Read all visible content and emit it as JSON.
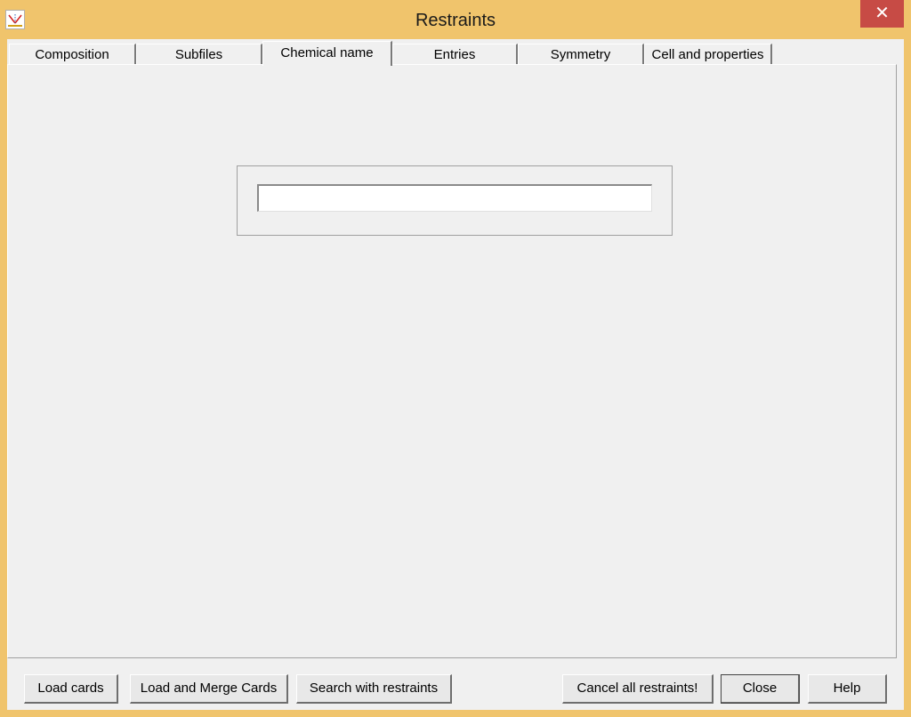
{
  "window": {
    "title": "Restraints",
    "close_glyph": "✕",
    "accent_color": "#f0c46c",
    "close_color": "#c74b45"
  },
  "tabs": [
    {
      "label": "Composition",
      "active": false
    },
    {
      "label": "Subfiles",
      "active": false
    },
    {
      "label": "Chemical name",
      "active": true
    },
    {
      "label": "Entries",
      "active": false
    },
    {
      "label": "Symmetry",
      "active": false
    },
    {
      "label": "Cell and properties",
      "active": false
    }
  ],
  "chemical_name": {
    "value": ""
  },
  "buttons": {
    "load_cards": "Load cards",
    "load_merge_cards": "Load and Merge Cards",
    "search_with_restraints": "Search with restraints",
    "cancel_all": "Cancel all restraints!",
    "close": "Close",
    "help": "Help"
  },
  "icons": {
    "app": "diffraction-app-icon",
    "close": "close-icon"
  }
}
